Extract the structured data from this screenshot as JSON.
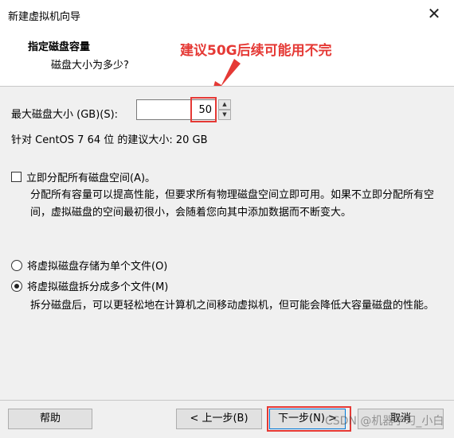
{
  "window": {
    "title": "新建虚拟机向导",
    "close_glyph": "✕"
  },
  "header": {
    "title": "指定磁盘容量",
    "subtitle": "磁盘大小为多少?"
  },
  "annotation": {
    "text": "建议50G后续可能用不完",
    "color": "#e53935"
  },
  "disk": {
    "label": "最大磁盘大小 (GB)(S):",
    "value": "50",
    "recommendation": "针对 CentOS 7 64 位 的建议大小: 20 GB"
  },
  "allocate": {
    "label": "立即分配所有磁盘空间(A)。",
    "checked": false,
    "description": "分配所有容量可以提高性能，但要求所有物理磁盘空间立即可用。如果不立即分配所有空间，虚拟磁盘的空间最初很小，会随着您向其中添加数据而不断变大。"
  },
  "storage": {
    "single_label": "将虚拟磁盘存储为单个文件(O)",
    "multi_label": "将虚拟磁盘拆分成多个文件(M)",
    "selected": "multi",
    "multi_description": "拆分磁盘后，可以更轻松地在计算机之间移动虚拟机，但可能会降低大容量磁盘的性能。"
  },
  "footer": {
    "help": "帮助",
    "back": "< 上一步(B)",
    "next": "下一步(N) >",
    "cancel": "取消"
  },
  "watermark": "CSDN @机器学习_小白"
}
